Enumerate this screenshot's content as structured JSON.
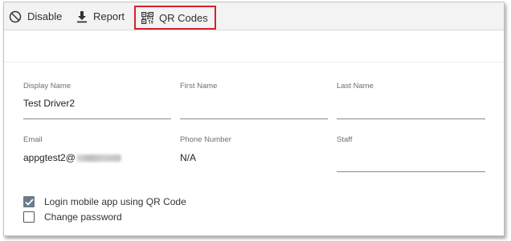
{
  "toolbar": {
    "disable_label": "Disable",
    "report_label": "Report",
    "qr_label": "QR Codes",
    "highlight_color": "#d9202a"
  },
  "form": {
    "display_name": {
      "label": "Display Name",
      "value": "Test Driver2"
    },
    "first_name": {
      "label": "First Name",
      "value": ""
    },
    "last_name": {
      "label": "Last Name",
      "value": ""
    },
    "email": {
      "label": "Email",
      "value_visible": "appgtest2@"
    },
    "phone": {
      "label": "Phone Number",
      "value": "N/A"
    },
    "staff": {
      "label": "Staff",
      "value": ""
    }
  },
  "options": {
    "login_qr": {
      "label": "Login mobile app using QR Code",
      "checked": true
    },
    "change_password": {
      "label": "Change password",
      "checked": false
    }
  }
}
